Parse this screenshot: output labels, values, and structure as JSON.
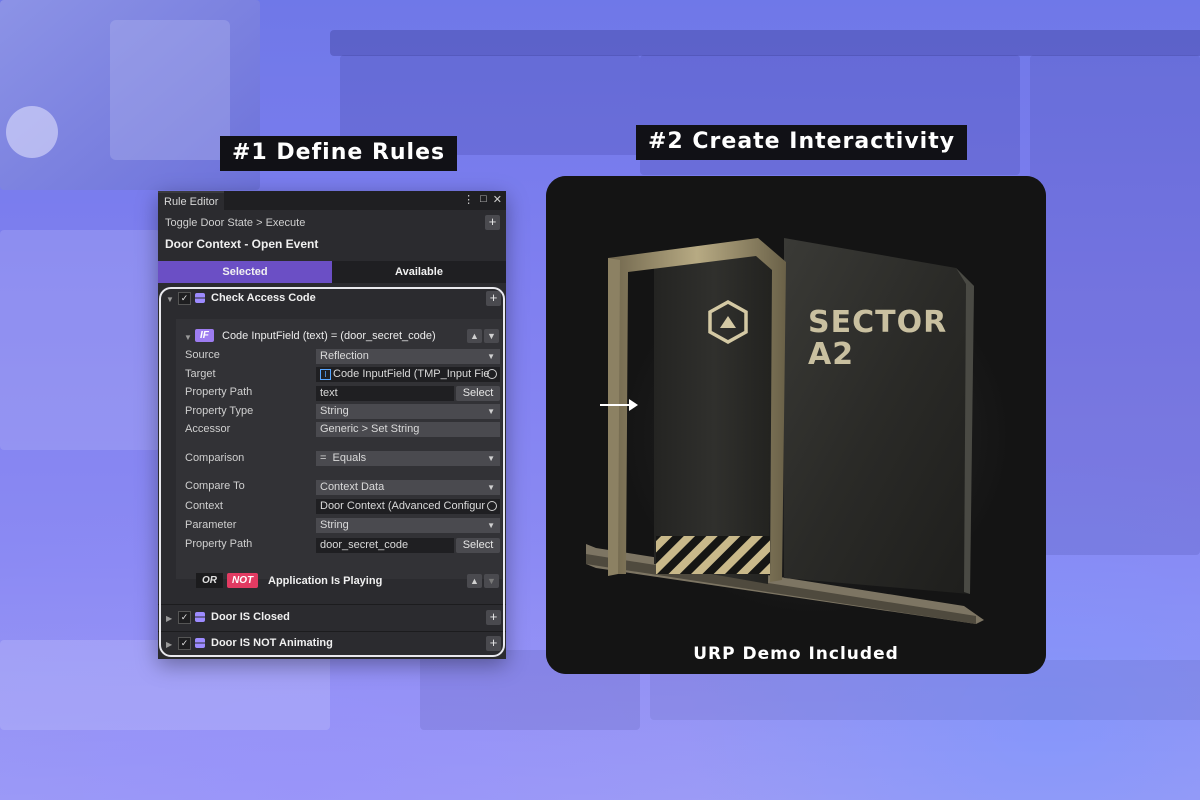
{
  "headings": {
    "define_rules": "#1 Define Rules",
    "create_interactivity": "#2 Create Interactivity"
  },
  "panel": {
    "title": "Rule Editor",
    "breadcrumb": "Toggle Door State > Execute",
    "context_title": "Door Context - Open Event",
    "tabs": [
      "Selected",
      "Available"
    ],
    "rules": [
      {
        "label": "Check Access Code",
        "checked": true
      },
      {
        "label": "Door IS Closed",
        "checked": true
      },
      {
        "label": "Door IS NOT Animating",
        "checked": true
      }
    ],
    "condition": {
      "badge": "IF",
      "title": "Code InputField (text) = (door_secret_code)",
      "properties": {
        "source_label": "Source",
        "source_value": "Reflection",
        "target_label": "Target",
        "target_value": "Code InputField (TMP_Input Fie",
        "path_label": "Property Path",
        "path_value": "text",
        "select_label": "Select",
        "type_label": "Property Type",
        "type_value": "String",
        "accessor_label": "Accessor",
        "accessor_value": "Generic > Set String",
        "comparison_label": "Comparison",
        "comparison_value": "=  Equals",
        "compare_to_label": "Compare To",
        "compare_to_value": "Context Data",
        "context_label": "Context",
        "context_value": "Door Context (Advanced Configur",
        "parameter_label": "Parameter",
        "parameter_value": "String",
        "path2_label": "Property Path",
        "path2_value": "door_secret_code",
        "select2_label": "Select"
      }
    },
    "or_condition": {
      "or_badge": "OR",
      "not_badge": "NOT",
      "label": "Application Is Playing"
    }
  },
  "demo": {
    "caption": "URP Demo Included",
    "door_sign_line1": "SECTOR",
    "door_sign_line2": "A2"
  },
  "colors": {
    "accent_purple": "#6b4fc5",
    "if_badge": "#9d7cf0",
    "not_badge": "#e23b62",
    "background": "#7f7ff0"
  }
}
